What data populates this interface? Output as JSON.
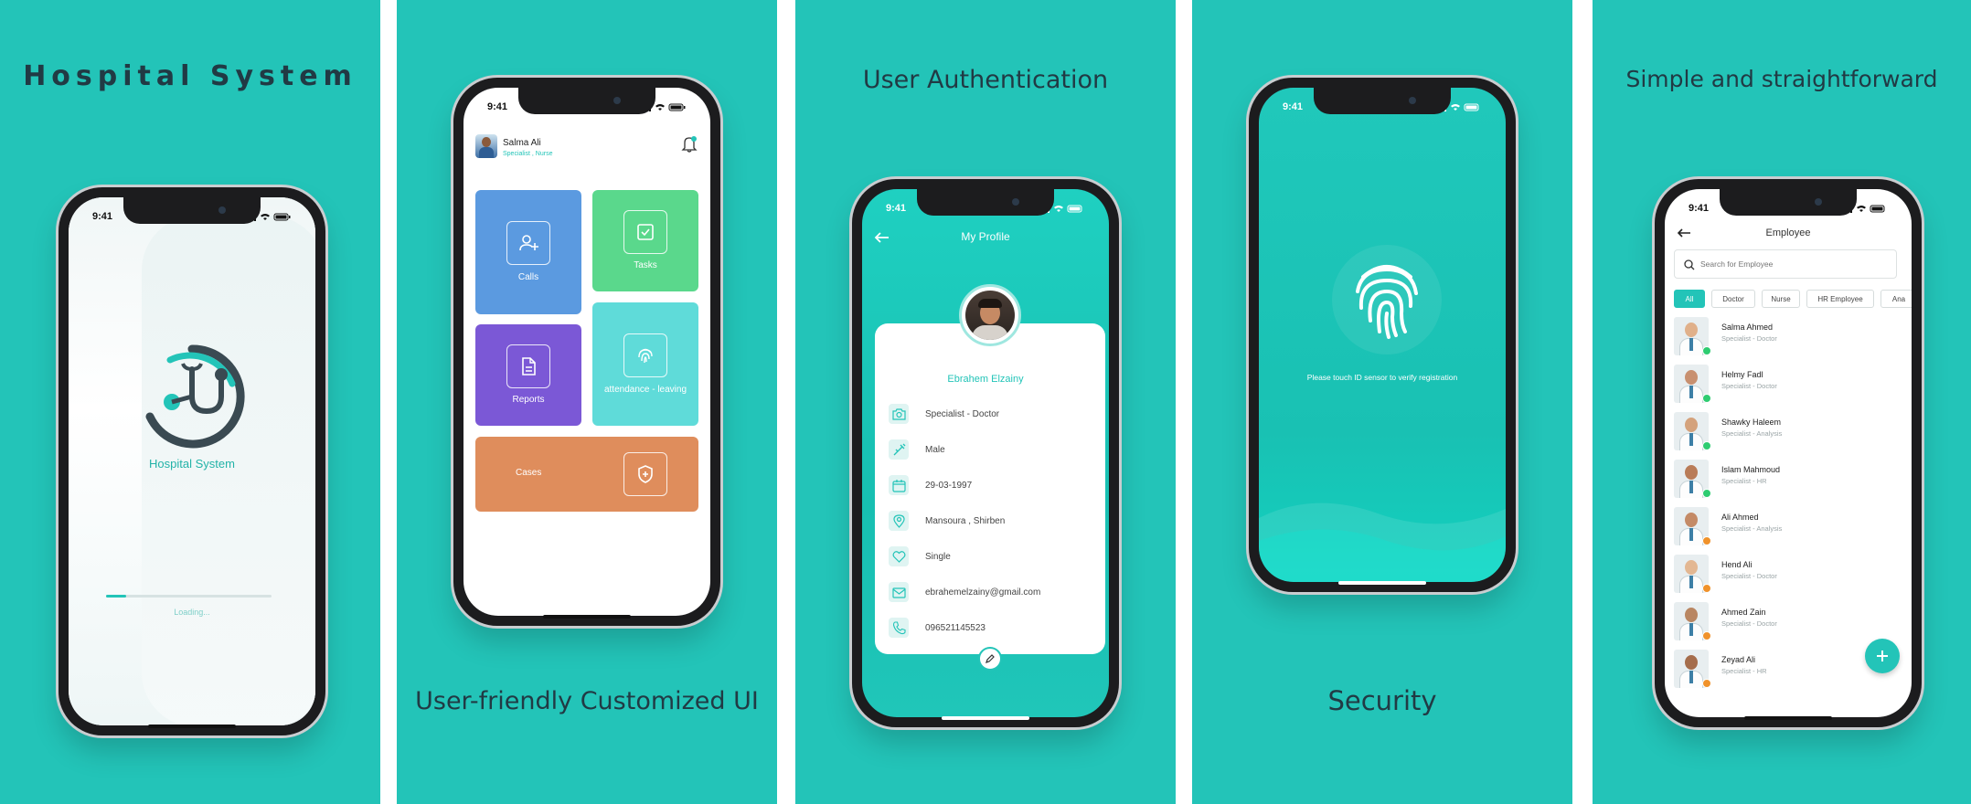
{
  "status_time": "9:41",
  "panels": {
    "p1": {
      "caption": "Hospital System",
      "app_name": "Hospital System",
      "loading": "Loading...",
      "progress": 0.12
    },
    "p2": {
      "caption": "User-friendly Customized UI",
      "user_name": "Salma Ali",
      "user_role": "Specialist , Nurse",
      "tiles": [
        {
          "label": "Calls",
          "color": "#5b9ae0",
          "icon": "user-plus-icon"
        },
        {
          "label": "Tasks",
          "color": "#5ad88c",
          "icon": "checkbox-icon"
        },
        {
          "label": "Reports",
          "color": "#7b58d6",
          "icon": "document-icon"
        },
        {
          "label": "attendance - leaving",
          "color": "#5fdbd9",
          "icon": "fingerprint-icon"
        },
        {
          "label": "Cases",
          "color": "#df8d5c",
          "icon": "shield-plus-icon"
        }
      ]
    },
    "p3": {
      "caption": "User Authentication",
      "title": "My Profile",
      "name": "Ebrahem Elzainy",
      "rows": [
        {
          "icon": "camera-icon",
          "text": "Specialist - Doctor"
        },
        {
          "icon": "syringe-icon",
          "text": "Male"
        },
        {
          "icon": "calendar-icon",
          "text": "29-03-1997"
        },
        {
          "icon": "location-icon",
          "text": "Mansoura , Shirben"
        },
        {
          "icon": "heart-icon",
          "text": "Single"
        },
        {
          "icon": "mail-icon",
          "text": "ebrahemelzainy@gmail.com"
        },
        {
          "icon": "phone-icon",
          "text": "096521145523"
        }
      ]
    },
    "p4": {
      "caption": "Security",
      "message": "Please touch ID sensor to verify registration"
    },
    "p5": {
      "caption": "Simple and straightforward",
      "title": "Employee",
      "search_placeholder": "Search for Employee",
      "filters": [
        "All",
        "Doctor",
        "Nurse",
        "HR Employee",
        "Ana"
      ],
      "employees": [
        {
          "name": "Salma Ahmed",
          "role": "Specialist - Doctor",
          "status": "#2ecc71"
        },
        {
          "name": "Helmy Fadl",
          "role": "Specialist - Doctor",
          "status": "#2ecc71"
        },
        {
          "name": "Shawky Haleem",
          "role": "Specialist - Analysis",
          "status": "#2ecc71"
        },
        {
          "name": "Islam Mahmoud",
          "role": "Specialist - HR",
          "status": "#2ecc71"
        },
        {
          "name": "Ali Ahmed",
          "role": "Specialist - Analysis",
          "status": "#f0922b"
        },
        {
          "name": "Hend Ali",
          "role": "Specialist - Doctor",
          "status": "#f0922b"
        },
        {
          "name": "Ahmed Zain",
          "role": "Specialist - Doctor",
          "status": "#f0922b"
        },
        {
          "name": "Zeyad Ali",
          "role": "Specialist - HR",
          "status": "#f0922b"
        }
      ]
    }
  },
  "colors": {
    "brand": "#23c4b8",
    "caption_text": "#213a44"
  }
}
